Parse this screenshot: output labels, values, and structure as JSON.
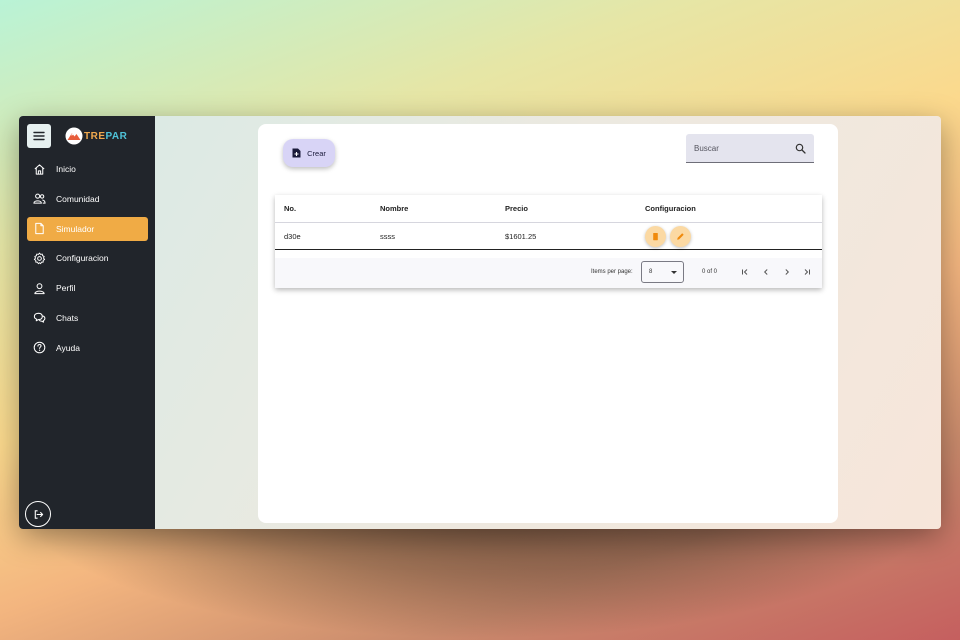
{
  "app": {
    "logo_part1": "TRE",
    "logo_part2": "PAR"
  },
  "sidebar": {
    "items": [
      {
        "label": "Inicio",
        "icon": "home-icon",
        "active": false
      },
      {
        "label": "Comunidad",
        "icon": "people-icon",
        "active": false
      },
      {
        "label": "Simulador",
        "icon": "document-icon",
        "active": true
      },
      {
        "label": "Configuracion",
        "icon": "gear-icon",
        "active": false
      },
      {
        "label": "Perfil",
        "icon": "person-icon",
        "active": false
      },
      {
        "label": "Chats",
        "icon": "chat-icon",
        "active": false
      },
      {
        "label": "Ayuda",
        "icon": "help-icon",
        "active": false
      }
    ]
  },
  "toolbar": {
    "create_label": "Crear",
    "search_placeholder": "Buscar"
  },
  "table": {
    "columns": [
      "No.",
      "Nombre",
      "Precio",
      "Configuracion"
    ],
    "rows": [
      {
        "no": "d30e",
        "nombre": "ssss",
        "precio": "$1601.25"
      }
    ]
  },
  "paginator": {
    "items_per_page_label": "Items per page:",
    "page_size": "8",
    "range_label": "0 of 0"
  },
  "colors": {
    "sidebar_bg": "#21252b",
    "accent": "#f0ab45",
    "create_button": "#d8d4f6"
  }
}
